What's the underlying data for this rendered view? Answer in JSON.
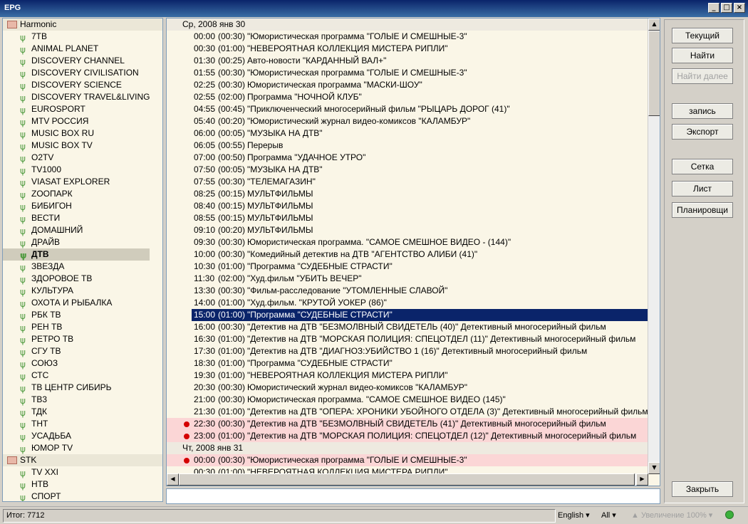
{
  "window": {
    "title": "EPG",
    "buttons": [
      "_",
      "□",
      "×"
    ]
  },
  "tree": {
    "groups": [
      {
        "name": "Harmonic",
        "channels": [
          "7ТВ",
          "ANIMAL PLANET",
          "DISCOVERY CHANNEL",
          "DISCOVERY CIVILISATION",
          "DISCOVERY SCIENCE",
          "DISCOVERY TRAVEL&LIVING",
          "EUROSPORT",
          "MTV РОССИЯ",
          "MUSIC BOX RU",
          "MUSIC BOX TV",
          "O2TV",
          "TV1000",
          "VIASAT EXPLORER",
          "ZOOПАРК",
          "БИБИГОН",
          "ВЕСТИ",
          "ДОМАШНИЙ",
          "ДРАЙВ",
          "ДТВ",
          "ЗВЕЗДА",
          "ЗДОРОВОЕ ТВ",
          "КУЛЬТУРА",
          "ОХОТА И РЫБАЛКА",
          "РБК ТВ",
          "РЕН ТВ",
          "РЕТРО ТВ",
          "СГУ ТВ",
          "СОЮЗ",
          "СТС",
          "ТВ ЦЕНТР СИБИРЬ",
          "ТВ3",
          "ТДК",
          "ТНТ",
          "УСАДЬБА",
          "ЮМОР TV"
        ]
      },
      {
        "name": "STK",
        "channels": [
          "TV XXI",
          "НТВ",
          "СПОРТ"
        ]
      }
    ],
    "selected": "ДТВ"
  },
  "schedule": [
    {
      "type": "date",
      "text": "Ср, 2008 янв 30"
    },
    {
      "time": "00:00",
      "dur": "(00:30)",
      "title": "\"Юмористическая программа \"ГОЛЫЕ И СМЕШНЫЕ-3\""
    },
    {
      "time": "00:30",
      "dur": "(01:00)",
      "title": "\"НЕВЕРОЯТНАЯ КОЛЛЕКЦИЯ МИСТЕРА РИПЛИ\""
    },
    {
      "time": "01:30",
      "dur": "(00:25)",
      "title": "Авто-новости \"КАРДАННЫЙ ВАЛ+\""
    },
    {
      "time": "01:55",
      "dur": "(00:30)",
      "title": "\"Юмористическая программа \"ГОЛЫЕ И СМЕШНЫЕ-3\""
    },
    {
      "time": "02:25",
      "dur": "(00:30)",
      "title": "Юмористическая программа \"МАСКИ-ШОУ\""
    },
    {
      "time": "02:55",
      "dur": "(02:00)",
      "title": "Программа \"НОЧНОЙ КЛУБ\""
    },
    {
      "time": "04:55",
      "dur": "(00:45)",
      "title": "\"Приключенческий многосерийный фильм \"РЫЦАРЬ ДОРОГ (41)\""
    },
    {
      "time": "05:40",
      "dur": "(00:20)",
      "title": "\"Юмористический журнал видео-комиксов \"КАЛАМБУР\""
    },
    {
      "time": "06:00",
      "dur": "(00:05)",
      "title": "\"МУЗЫКА НА ДТВ\""
    },
    {
      "time": "06:05",
      "dur": "(00:55)",
      "title": "Перерыв"
    },
    {
      "time": "07:00",
      "dur": "(00:50)",
      "title": "Программа \"УДАЧНОЕ УТРО\""
    },
    {
      "time": "07:50",
      "dur": "(00:05)",
      "title": "\"МУЗЫКА НА ДТВ\""
    },
    {
      "time": "07:55",
      "dur": "(00:30)",
      "title": "\"ТЕЛЕМАГАЗИН\""
    },
    {
      "time": "08:25",
      "dur": "(00:15)",
      "title": "МУЛЬТФИЛЬМЫ"
    },
    {
      "time": "08:40",
      "dur": "(00:15)",
      "title": "МУЛЬТФИЛЬМЫ"
    },
    {
      "time": "08:55",
      "dur": "(00:15)",
      "title": "МУЛЬТФИЛЬМЫ"
    },
    {
      "time": "09:10",
      "dur": "(00:20)",
      "title": "МУЛЬТФИЛЬМЫ"
    },
    {
      "time": "09:30",
      "dur": "(00:30)",
      "title": "Юмористическая программа. \"САМОЕ СМЕШНОЕ ВИДЕО - (144)\""
    },
    {
      "time": "10:00",
      "dur": "(00:30)",
      "title": "\"Комедийный детектив на ДТВ \"АГЕНТСТВО АЛИБИ (41)\""
    },
    {
      "time": "10:30",
      "dur": "(01:00)",
      "title": "\"Программа \"СУДЕБНЫЕ СТРАСТИ\""
    },
    {
      "time": "11:30",
      "dur": "(02:00)",
      "title": "\"Худ.фильм \"УБИТЬ ВЕЧЕР\""
    },
    {
      "time": "13:30",
      "dur": "(00:30)",
      "title": "\"Фильм-расследование \"УТОМЛЕННЫЕ СЛАВОЙ\""
    },
    {
      "time": "14:00",
      "dur": "(01:00)",
      "title": "\"Худ.фильм. \"КРУТОЙ УОКЕР (86)\""
    },
    {
      "time": "15:00",
      "dur": "(01:00)",
      "title": "\"Программа \"СУДЕБНЫЕ СТРАСТИ\"",
      "selected": true
    },
    {
      "time": "16:00",
      "dur": "(00:30)",
      "title": "\"Детектив на ДТВ \"БЕЗМОЛВНЫЙ СВИДЕТЕЛЬ (40)\" Детективный многосерийный фильм"
    },
    {
      "time": "16:30",
      "dur": "(01:00)",
      "title": "\"Детектив на ДТВ \"МОРСКАЯ ПОЛИЦИЯ: СПЕЦОТДЕЛ (11)\" Детективный многосерийный фильм"
    },
    {
      "time": "17:30",
      "dur": "(01:00)",
      "title": "\"Детектив на ДТВ \"ДИАГНОЗ:УБИЙСТВО 1 (16)\" Детективный многосерийный фильм"
    },
    {
      "time": "18:30",
      "dur": "(01:00)",
      "title": "\"Программа \"СУДЕБНЫЕ СТРАСТИ\""
    },
    {
      "time": "19:30",
      "dur": "(01:00)",
      "title": "\"НЕВЕРОЯТНАЯ КОЛЛЕКЦИЯ МИСТЕРА РИПЛИ\""
    },
    {
      "time": "20:30",
      "dur": "(00:30)",
      "title": "Юмористический журнал видео-комиксов \"КАЛАМБУР\""
    },
    {
      "time": "21:00",
      "dur": "(00:30)",
      "title": "Юмористическая программа. \"САМОЕ СМЕШНОЕ ВИДЕО (145)\""
    },
    {
      "time": "21:30",
      "dur": "(01:00)",
      "title": "\"Детектив на ДТВ \"ОПЕРА: ХРОНИКИ УБОЙНОГО ОТДЕЛА (3)\" Детективный многосерийный фильм"
    },
    {
      "time": "22:30",
      "dur": "(00:30)",
      "title": "\"Детектив на ДТВ \"БЕЗМОЛВНЫЙ СВИДЕТЕЛЬ (41)\" Детективный многосерийный фильм",
      "rec": true
    },
    {
      "time": "23:00",
      "dur": "(01:00)",
      "title": "\"Детектив на ДТВ \"МОРСКАЯ ПОЛИЦИЯ: СПЕЦОТДЕЛ (12)\" Детективный многосерийный фильм",
      "rec": true
    },
    {
      "type": "date",
      "text": "Чт, 2008 янв 31"
    },
    {
      "time": "00:00",
      "dur": "(00:30)",
      "title": "\"Юмористическая программа \"ГОЛЫЕ И СМЕШНЫЕ-3\"",
      "rec": true
    },
    {
      "time": "00:30",
      "dur": "(01:00)",
      "title": "\"НЕВЕРОЯТНАЯ КОЛЛЕКЦИЯ МИСТЕРА РИПЛИ\""
    }
  ],
  "search": {
    "value": ""
  },
  "buttons": {
    "current": "Текущий",
    "find": "Найти",
    "find_next": "Найти далее",
    "record": "запись",
    "export": "Экспорт",
    "grid": "Сетка",
    "list": "Лист",
    "scheduler": "Планировщи",
    "close": "Закрыть"
  },
  "status": {
    "total": "Итог: 7712",
    "language": "English",
    "filter": "All",
    "zoom": "Увеличение 100%"
  }
}
